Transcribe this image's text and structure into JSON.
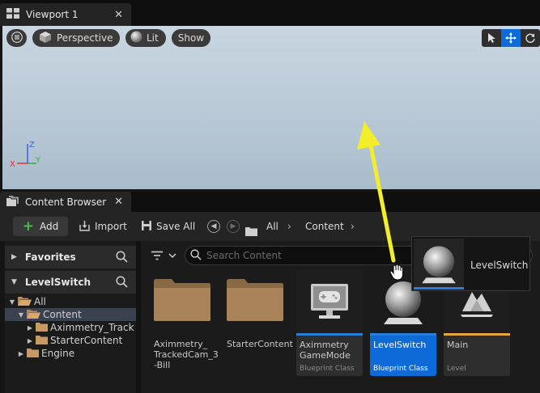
{
  "viewport_tab": {
    "title": "Viewport 1",
    "close": "✕"
  },
  "viewport": {
    "perspective_label": "Perspective",
    "lit_label": "Lit",
    "show_label": "Show",
    "axis": {
      "z": "Z",
      "y": "Y",
      "x": "X"
    }
  },
  "content_browser_tab": {
    "title": "Content Browser",
    "close": "✕"
  },
  "toolbar": {
    "add_label": "Add",
    "add_symbol": "+",
    "import_label": "Import",
    "save_all_label": "Save All",
    "breadcrumb": [
      "All",
      "Content"
    ],
    "separator": "›"
  },
  "left_panel": {
    "favorites_label": "Favorites",
    "project_label": "LevelSwitch",
    "tree": [
      {
        "label": "All",
        "depth": 0,
        "expanded": true,
        "selected": false
      },
      {
        "label": "Content",
        "depth": 1,
        "expanded": true,
        "selected": true
      },
      {
        "label": "Aximmetry_Track",
        "depth": 2,
        "expanded": false,
        "selected": false
      },
      {
        "label": "StarterContent",
        "depth": 2,
        "expanded": false,
        "selected": false
      },
      {
        "label": "Engine",
        "depth": 1,
        "expanded": false,
        "selected": false
      }
    ]
  },
  "content_area": {
    "search_placeholder": "Search Content",
    "folders": [
      {
        "name": "Aximmetry_ TrackedCam_3 -Bill"
      },
      {
        "name": "StarterContent"
      }
    ],
    "assets": [
      {
        "name": "Aximmetry GameMode",
        "type": "Blueprint Class",
        "stripe": "#2d7dd8",
        "selected": false
      },
      {
        "name": "LevelSwitch",
        "type": "Blueprint Class",
        "stripe": "#2d7dd8",
        "selected": true
      },
      {
        "name": "Main",
        "type": "Level",
        "stripe": "#e8a640",
        "selected": false
      }
    ]
  },
  "drag_tooltip": {
    "label": "LevelSwitch"
  },
  "colors": {
    "accent_blue": "#0e6ad6",
    "add_green": "#45c145",
    "annotation_arrow": "#f2ee2a",
    "level_orange": "#e8a640"
  }
}
